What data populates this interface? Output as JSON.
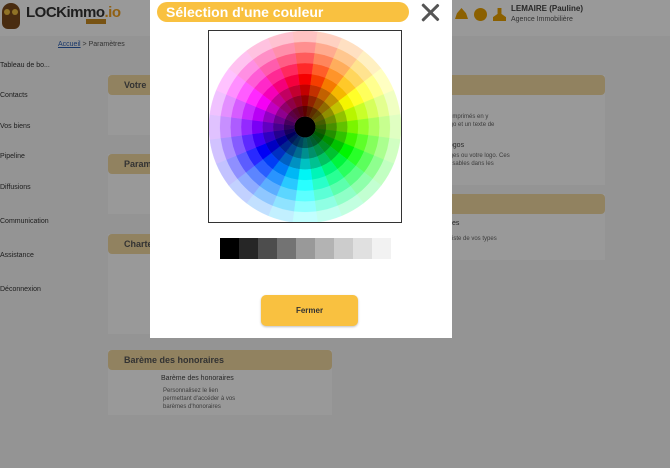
{
  "brand": {
    "logo_text": "LOCKimmo",
    "logo_suffix": ".io"
  },
  "user": {
    "name": "LEMAIRE (Pauline)",
    "role": "Agence Immobilière"
  },
  "header_icons": [
    "bell-icon",
    "gear-icon",
    "user-icon"
  ],
  "breadcrumb": {
    "home": "Accueil",
    "sep": ">",
    "current": "Paramètres"
  },
  "sidebar": {
    "items": [
      {
        "label": "Tableau de bo..."
      },
      {
        "label": "Contacts"
      },
      {
        "label": "Vos biens"
      },
      {
        "label": "Pipeline"
      },
      {
        "label": "Diffusions"
      },
      {
        "label": "Communication"
      },
      {
        "label": "Assistance"
      },
      {
        "label": "Déconnexion"
      }
    ]
  },
  "cards": {
    "votre": {
      "title": "Votre"
    },
    "param": {
      "title": "Param"
    },
    "charte": {
      "title": "Charte"
    },
    "bareme": {
      "title": "Barème des honoraires",
      "item_title": "Barème des honoraires",
      "desc_1": "Personnalisez le lien",
      "desc_2": "permettant d'accéder à vos",
      "desc_3": "barèmes d'honoraires"
    },
    "right_1": {
      "line_1": "vos imprimés en y",
      "line_2": "e logo et un texte de",
      "item_title": "s / logos",
      "line_3": "images ou votre logo. Ces",
      "line_4": "t utilisables dans les"
    },
    "right_2": {
      "label": "es",
      "desc": "iste de vos types"
    }
  },
  "modal": {
    "title": "Sélection d'une couleur",
    "close_button": "Fermer",
    "grays": [
      "#000000",
      "#262626",
      "#4d4d4d",
      "#737373",
      "#999999",
      "#b3b3b3",
      "#cccccc",
      "#e0e0e0",
      "#f2f2f2"
    ]
  },
  "colors": {
    "accent": "#f9c140",
    "header_band": "#f2d9a0",
    "overlay": "rgba(0,0,0,0.4)"
  }
}
